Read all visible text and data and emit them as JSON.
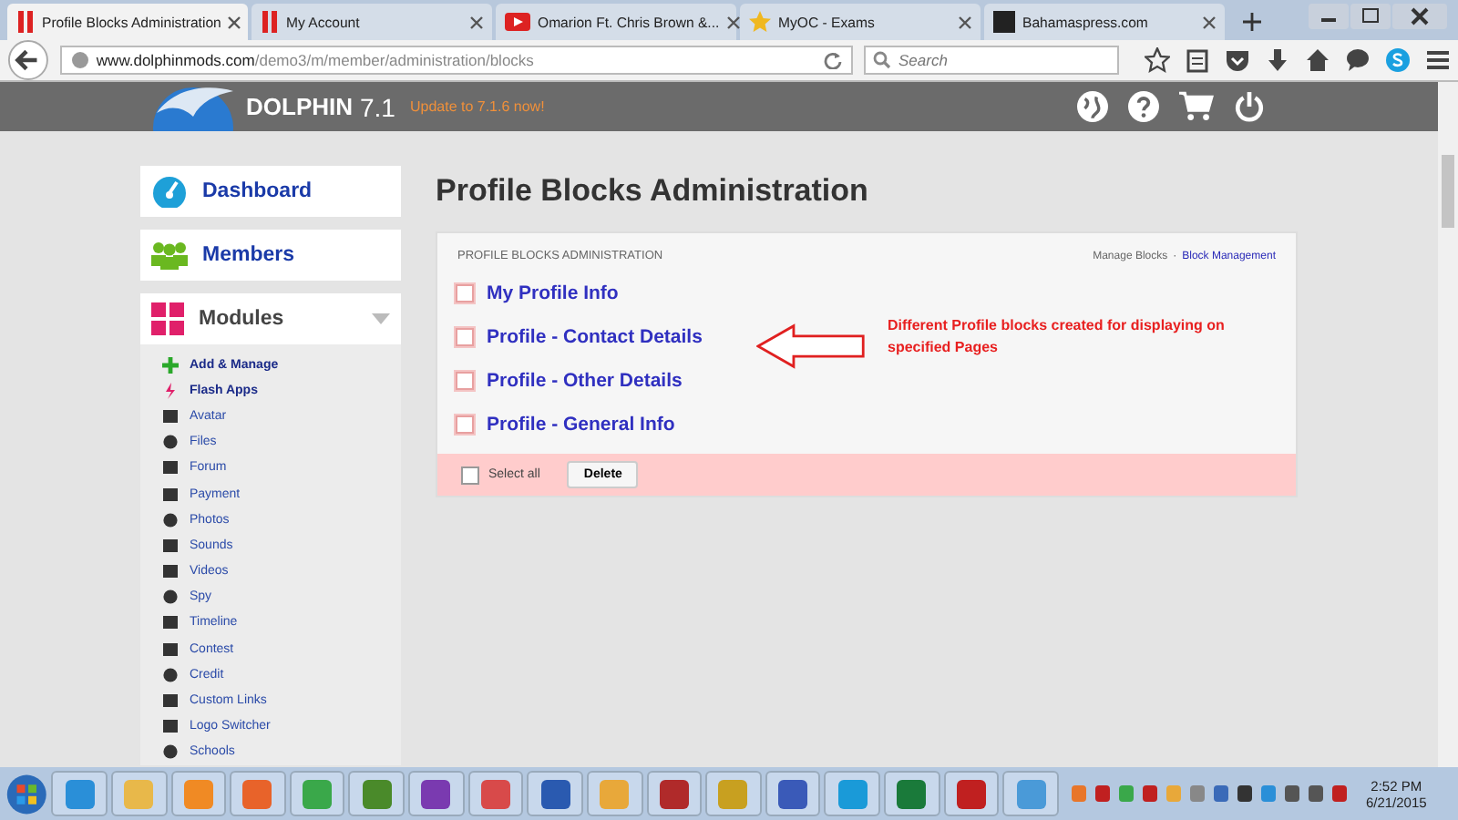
{
  "browser": {
    "tabs": [
      {
        "title": "Profile Blocks Administration",
        "selected": true
      },
      {
        "title": "My Account",
        "selected": false
      },
      {
        "title": "Omarion Ft. Chris Brown &...",
        "selected": false
      },
      {
        "title": "MyOC - Exams",
        "selected": false
      },
      {
        "title": "Bahamaspress.com",
        "selected": false
      }
    ],
    "url_host": "www.dolphinmods.com",
    "url_path": "/demo3/m/member/administration/blocks",
    "search_placeholder": "Search"
  },
  "header": {
    "brand": "DOLPHIN",
    "version": "7.1",
    "update": "Update to 7.1.6 now!"
  },
  "sidebar": {
    "sections": [
      {
        "label": "Dashboard",
        "kind": "dashboard"
      },
      {
        "label": "Members",
        "kind": "members"
      },
      {
        "label": "Modules",
        "kind": "modules",
        "expanded": true,
        "items": [
          {
            "label": "Add & Manage",
            "bold": true
          },
          {
            "label": "Flash Apps",
            "bold": true
          },
          {
            "label": "Avatar",
            "bold": false
          },
          {
            "label": "Files",
            "bold": false
          },
          {
            "label": "Forum",
            "bold": false
          },
          {
            "label": "Payment",
            "bold": false
          },
          {
            "label": "Photos",
            "bold": false
          },
          {
            "label": "Sounds",
            "bold": false
          },
          {
            "label": "Videos",
            "bold": false
          },
          {
            "label": "Spy",
            "bold": false
          },
          {
            "label": "Timeline",
            "bold": false
          },
          {
            "label": "Contest",
            "bold": false
          },
          {
            "label": "Credit",
            "bold": false
          },
          {
            "label": "Custom Links",
            "bold": false
          },
          {
            "label": "Logo Switcher",
            "bold": false
          },
          {
            "label": "Schools",
            "bold": false
          }
        ]
      }
    ]
  },
  "main": {
    "title": "Profile Blocks Administration",
    "panel_heading": "PROFILE BLOCKS ADMINISTRATION",
    "links": [
      {
        "label": "Manage Blocks",
        "selected": false
      },
      {
        "label": "Block Management",
        "selected": true
      }
    ],
    "link_separator": "·",
    "blocks": [
      {
        "label": "My Profile Info",
        "checked": false
      },
      {
        "label": "Profile - Contact Details",
        "checked": false
      },
      {
        "label": "Profile - Other Details",
        "checked": false
      },
      {
        "label": "Profile - General Info",
        "checked": false
      }
    ],
    "annotation": "Different Profile blocks created for displaying on specified Pages",
    "select_all": {
      "label": "Select all",
      "checked": false
    },
    "delete_button": "Delete"
  },
  "taskbar": {
    "time": "2:52 PM",
    "date": "6/21/2015"
  }
}
